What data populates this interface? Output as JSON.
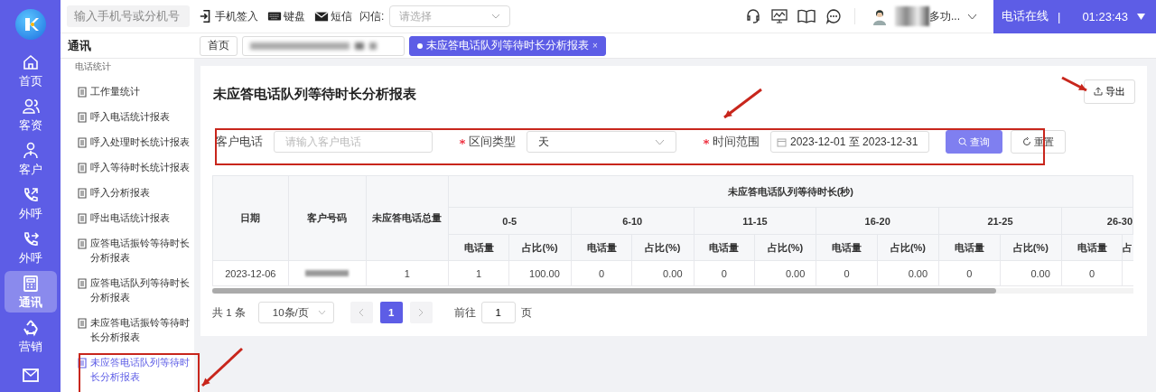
{
  "rail": {
    "items": [
      {
        "label": "首页",
        "selected": false
      },
      {
        "label": "客资",
        "selected": false
      },
      {
        "label": "客户",
        "selected": false
      },
      {
        "label": "外呼",
        "selected": false
      },
      {
        "label": "外呼",
        "selected": false
      },
      {
        "label": "通讯",
        "selected": true
      },
      {
        "label": "营销",
        "selected": false
      }
    ]
  },
  "topbar": {
    "search_placeholder": "输入手机号或分机号",
    "actions": [
      {
        "label": "手机签入"
      },
      {
        "label": "键盘"
      },
      {
        "label": "短信"
      }
    ],
    "flash": {
      "label": "闪信:",
      "placeholder": "请选择"
    },
    "user_name": "多功...",
    "phone_status": {
      "label": "电话在线",
      "separator": "|",
      "timer": "01:23:43"
    }
  },
  "section_title": "通讯",
  "tabs": [
    {
      "label": "首页",
      "selected": false,
      "redacted": false
    },
    {
      "selected": false,
      "redacted": true
    },
    {
      "label": "未应答电话队列等待时长分析报表",
      "selected": true,
      "redacted": false,
      "close": "×"
    }
  ],
  "subnav": {
    "group": "电话统计",
    "items": [
      {
        "label": "工作量统计",
        "selected": false
      },
      {
        "label": "呼入电话统计报表",
        "selected": false
      },
      {
        "label": "呼入处理时长统计报表",
        "selected": false
      },
      {
        "label": "呼入等待时长统计报表",
        "selected": false
      },
      {
        "label": "呼入分析报表",
        "selected": false
      },
      {
        "label": "呼出电话统计报表",
        "selected": false
      },
      {
        "label": "应答电话振铃等待时长分析报表",
        "selected": false
      },
      {
        "label": "应答电话队列等待时长分析报表",
        "selected": false
      },
      {
        "label": "未应答电话振铃等待时长分析报表",
        "selected": false
      },
      {
        "label": "未应答电话队列等待时长分析报表",
        "selected": true
      }
    ]
  },
  "report": {
    "title": "未应答电话队列等待时长分析报表",
    "export": "导出",
    "filters": [
      {
        "kind": "input",
        "label": "客户电话",
        "required": false,
        "placeholder": "请输入客户电话"
      },
      {
        "kind": "select",
        "label": "区间类型",
        "required": true,
        "value": "天"
      },
      {
        "kind": "daterange",
        "label": "时间范围",
        "required": true,
        "value": "2023-12-01 至 2023-12-31"
      }
    ],
    "query": "查询",
    "reset": "重置",
    "table": {
      "fixed_columns": [
        "日期",
        "客户号码",
        "未应答电话总量"
      ],
      "group_title": "未应答电话队列等待时长(秒)",
      "groups": [
        {
          "range": "0-5",
          "count_label": "电话量",
          "ratio_label": "占比(%)"
        },
        {
          "range": "6-10",
          "count_label": "电话量",
          "ratio_label": "占比(%)"
        },
        {
          "range": "11-15",
          "count_label": "电话量",
          "ratio_label": "占比(%)"
        },
        {
          "range": "16-20",
          "count_label": "电话量",
          "ratio_label": "占比(%)"
        },
        {
          "range": "21-25",
          "count_label": "电话量",
          "ratio_label": "占比(%)"
        },
        {
          "range": "26-30",
          "count_label": "电话量",
          "ratio_label": "占"
        }
      ],
      "rows": [
        {
          "date": "2023-12-06",
          "customer_redacted": true,
          "total": "1",
          "cells": [
            [
              "1",
              "100.00"
            ],
            [
              "0",
              "0.00"
            ],
            [
              "0",
              "0.00"
            ],
            [
              "0",
              "0.00"
            ],
            [
              "0",
              "0.00"
            ],
            [
              "0"
            ]
          ]
        }
      ]
    },
    "pagination": {
      "total": "共 1 条",
      "page_size": "10条/页",
      "pages": [
        {
          "label": "1",
          "selected": true
        }
      ],
      "goto_label": "前往",
      "goto_value": "1",
      "goto_suffix": "页"
    }
  }
}
